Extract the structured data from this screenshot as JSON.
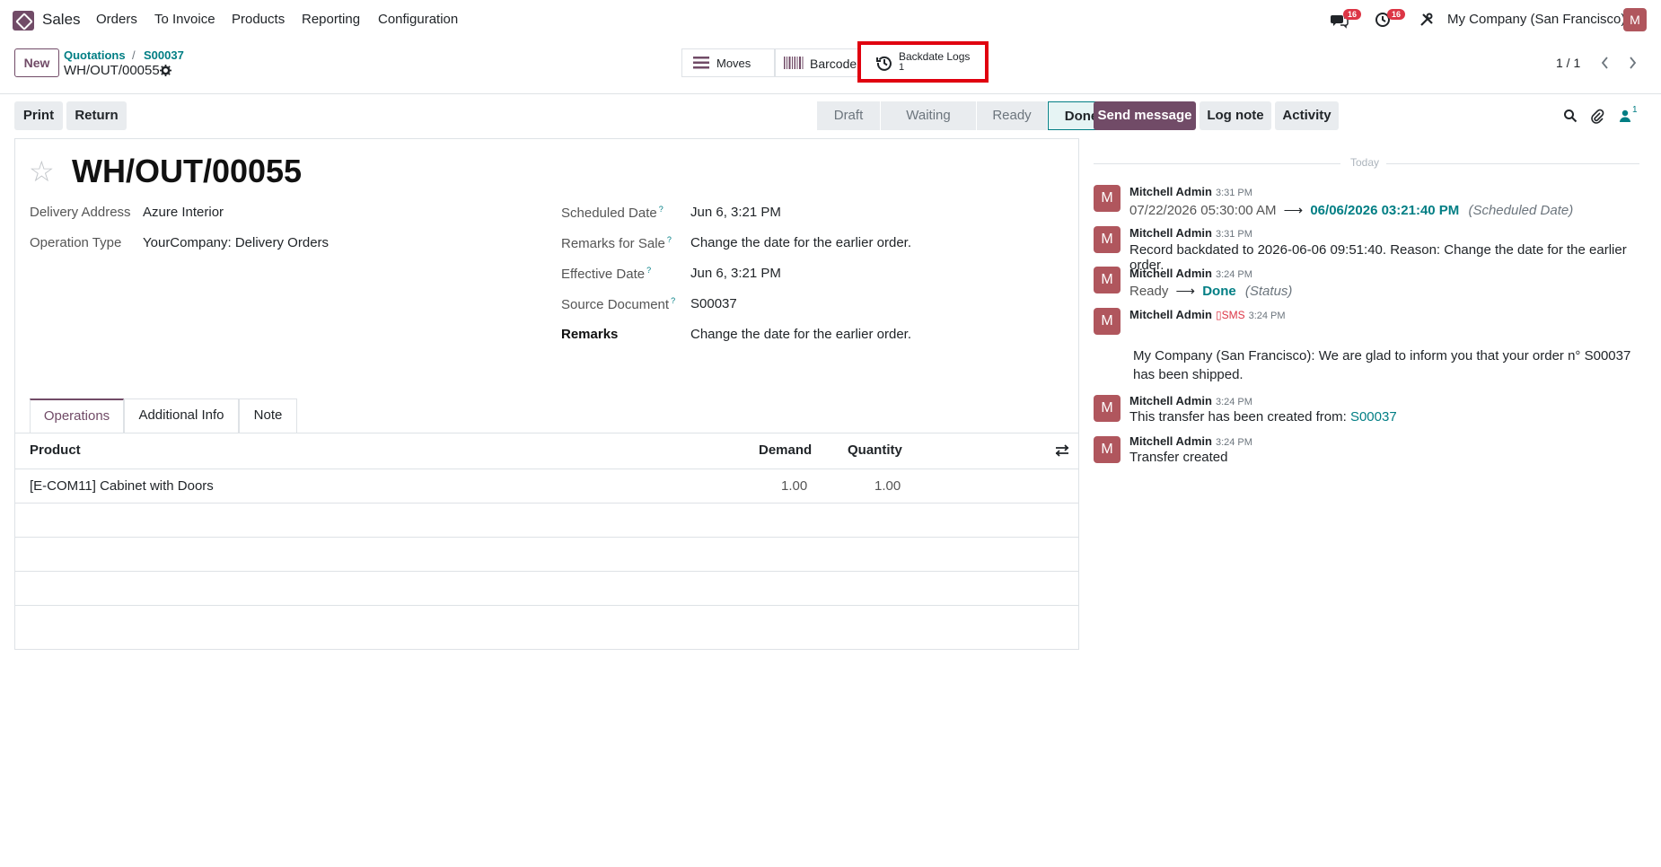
{
  "navbar": {
    "app_name": "Sales",
    "menu": [
      "Orders",
      "To Invoice",
      "Products",
      "Reporting",
      "Configuration"
    ],
    "messages_badge": "16",
    "activities_badge": "16",
    "company": "My Company (San Francisco)",
    "avatar_letter": "M"
  },
  "control_panel": {
    "new_label": "New",
    "breadcrumb": [
      "Quotations",
      "S00037"
    ],
    "breadcrumb_sep": "/",
    "current_record": "WH/OUT/00055",
    "smart_buttons": {
      "moves": "Moves",
      "barcode": "Barcode",
      "backdate_logs": "Backdate Logs",
      "backdate_count": "1"
    },
    "pager": "1 / 1"
  },
  "actions": {
    "print": "Print",
    "return": "Return"
  },
  "statusbar": {
    "stages": [
      "Draft",
      "Waiting",
      "Ready",
      "Done"
    ],
    "current": "Done"
  },
  "form": {
    "title": "WH/OUT/00055",
    "left_fields": [
      {
        "label": "Delivery Address",
        "value": "Azure Interior"
      },
      {
        "label": "Operation Type",
        "value": "YourCompany: Delivery Orders"
      }
    ],
    "right_fields": [
      {
        "label": "Scheduled Date",
        "value": "Jun 6, 3:21 PM",
        "help": "?"
      },
      {
        "label": "Remarks for Sale",
        "value": "Change the date for the earlier order.",
        "help": "?"
      },
      {
        "label": "Effective Date",
        "value": "Jun 6, 3:21 PM",
        "help": "?"
      },
      {
        "label": "Source Document",
        "value": "S00037",
        "help": "?"
      },
      {
        "label": "Remarks",
        "value": "Change the date for the earlier order."
      }
    ],
    "tabs": [
      "Operations",
      "Additional Info",
      "Note"
    ],
    "table": {
      "headers": [
        "Product",
        "Demand",
        "Quantity"
      ],
      "rows": [
        {
          "product": "[E-COM11] Cabinet with Doors",
          "demand": "1.00",
          "quantity": "1.00"
        }
      ]
    }
  },
  "chatter": {
    "send_message": "Send message",
    "log_note": "Log note",
    "activity": "Activity",
    "followers_count": "1",
    "date_separator": "Today",
    "messages": [
      {
        "author": "Mitchell Admin",
        "time": "3:31 PM",
        "old": "07/22/2026 05:30:00 AM",
        "new": "06/06/2026 03:21:40 PM",
        "field": "(Scheduled Date)"
      },
      {
        "author": "Mitchell Admin",
        "time": "3:31 PM",
        "body": "Record backdated to 2026-06-06 09:51:40. Reason: Change the date for the earlier order."
      },
      {
        "author": "Mitchell Admin",
        "time": "3:24 PM",
        "old": "Ready",
        "new": "Done",
        "field": "(Status)"
      },
      {
        "author": "Mitchell Admin",
        "sms": "SMS",
        "time": "3:24 PM",
        "body": "My Company (San Francisco): We are glad to inform you that your order n° S00037 has been shipped."
      },
      {
        "author": "Mitchell Admin",
        "time": "3:24 PM",
        "body": "This transfer has been created from:",
        "link": "S00037"
      },
      {
        "author": "Mitchell Admin",
        "time": "3:24 PM",
        "body": "Transfer created"
      }
    ]
  }
}
